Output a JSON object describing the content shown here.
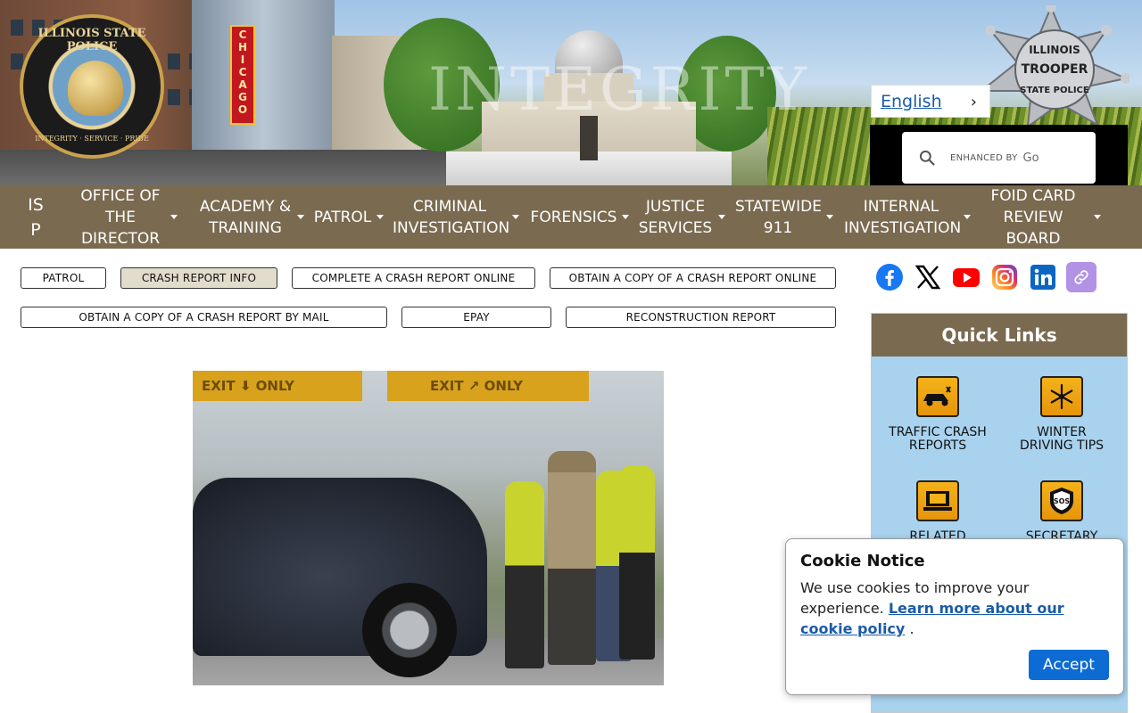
{
  "banner": {
    "overlay_word": "INTEGRITY",
    "city_sign": "CHICAGO",
    "seal": {
      "top_text": "ILLINOIS STATE POLICE",
      "bottom_text": "INTEGRITY · SERVICE · PRIDE"
    },
    "badge": {
      "line1": "ILLINOIS",
      "line2": "TROOPER",
      "line3": "STATE POLICE"
    }
  },
  "language": {
    "selected": "English"
  },
  "search": {
    "enhanced_by": "ENHANCED BY",
    "provider": "Go"
  },
  "nav": {
    "items": [
      {
        "label": "IS\nP",
        "has_menu": false
      },
      {
        "label": "OFFICE OF THE DIRECTOR",
        "has_menu": true
      },
      {
        "label": "ACADEMY & TRAINING",
        "has_menu": true
      },
      {
        "label": "PATROL",
        "has_menu": true
      },
      {
        "label": "CRIMINAL INVESTIGATION",
        "has_menu": true
      },
      {
        "label": "FORENSICS",
        "has_menu": true
      },
      {
        "label": "JUSTICE SERVICES",
        "has_menu": true
      },
      {
        "label": "STATEWIDE 911",
        "has_menu": true
      },
      {
        "label": "INTERNAL INVESTIGATION",
        "has_menu": true
      },
      {
        "label": "FOID CARD REVIEW BOARD",
        "has_menu": true
      }
    ]
  },
  "subnav": {
    "patrol": "PATROL",
    "crash_report_info": "CRASH REPORT INFO",
    "complete_online": "COMPLETE A CRASH REPORT ONLINE",
    "obtain_online": "OBTAIN A COPY OF A CRASH REPORT ONLINE",
    "obtain_mail": "OBTAIN A COPY OF A CRASH REPORT BY MAIL",
    "epay": "EPAY",
    "reconstruction": "RECONSTRUCTION REPORT",
    "active": "CRASH REPORT INFO"
  },
  "hero": {
    "sign_left": "EXIT ⬇ ONLY",
    "sign_right": "EXIT ↗ ONLY"
  },
  "social": [
    "facebook-icon",
    "x-icon",
    "youtube-icon",
    "instagram-icon",
    "linkedin-icon",
    "link-icon"
  ],
  "quick_links": {
    "title": "Quick Links",
    "tiles": [
      {
        "label": "TRAFFIC CRASH REPORTS",
        "icon": "crash-car-icon"
      },
      {
        "label": "WINTER DRIVING TIPS",
        "icon": "snowflake-icon"
      },
      {
        "label": "RELATED",
        "icon": "laptop-icon"
      },
      {
        "label": "SECRETARY",
        "icon": "sos-shield-icon"
      }
    ]
  },
  "cookie": {
    "title": "Cookie Notice",
    "text": "We use cookies to improve your experience.",
    "link": "Learn more about our cookie policy",
    "suffix": ".",
    "accept": "Accept"
  },
  "colors": {
    "nav_bg": "#7a6a50",
    "quick_links_bg": "#a8d2ee",
    "accept_bg": "#0d6bd4",
    "link": "#1a5ca8"
  }
}
